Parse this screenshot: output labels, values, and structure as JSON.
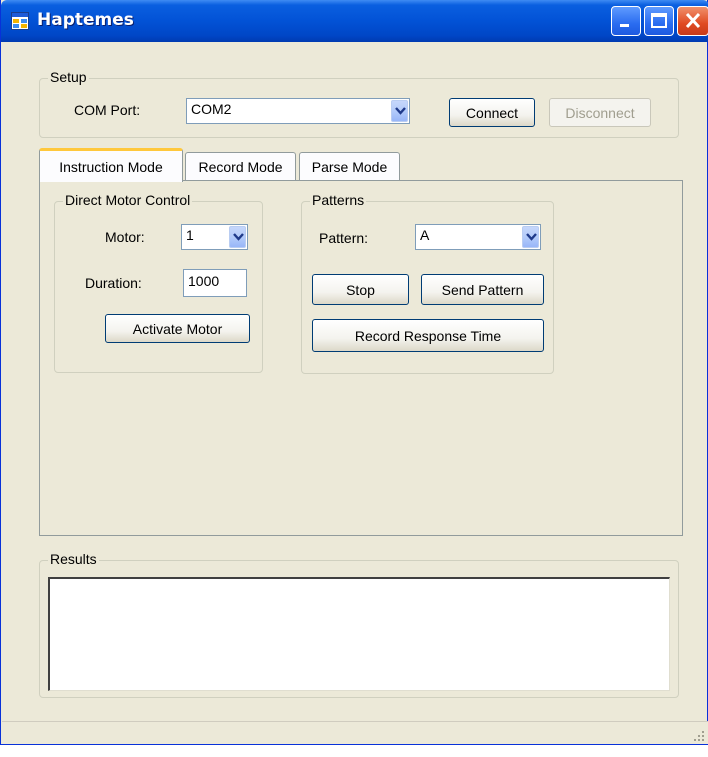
{
  "window": {
    "title": "Haptemes"
  },
  "setup": {
    "legend": "Setup",
    "com_port_label": "COM Port:",
    "com_port_value": "COM2",
    "connect_label": "Connect",
    "disconnect_label": "Disconnect"
  },
  "tabs": [
    {
      "label": "Instruction Mode",
      "active": true
    },
    {
      "label": "Record Mode",
      "active": false
    },
    {
      "label": "Parse Mode",
      "active": false
    }
  ],
  "direct_motor": {
    "legend": "Direct Motor Control",
    "motor_label": "Motor:",
    "motor_value": "1",
    "duration_label": "Duration:",
    "duration_value": "1000",
    "activate_label": "Activate Motor"
  },
  "patterns": {
    "legend": "Patterns",
    "pattern_label": "Pattern:",
    "pattern_value": "A",
    "stop_label": "Stop",
    "send_label": "Send Pattern",
    "record_label": "Record Response Time"
  },
  "results": {
    "legend": "Results",
    "content": ""
  },
  "colors": {
    "title_bar": "#0252D6",
    "face": "#ECE9D8",
    "active_tab_accent": "#FFC83C"
  },
  "icons": {
    "app": "app-window-icon",
    "minimize": "minimize-icon",
    "maximize": "maximize-icon",
    "close": "close-icon",
    "dropdown": "chevron-down-icon",
    "grip": "resize-grip-icon"
  }
}
